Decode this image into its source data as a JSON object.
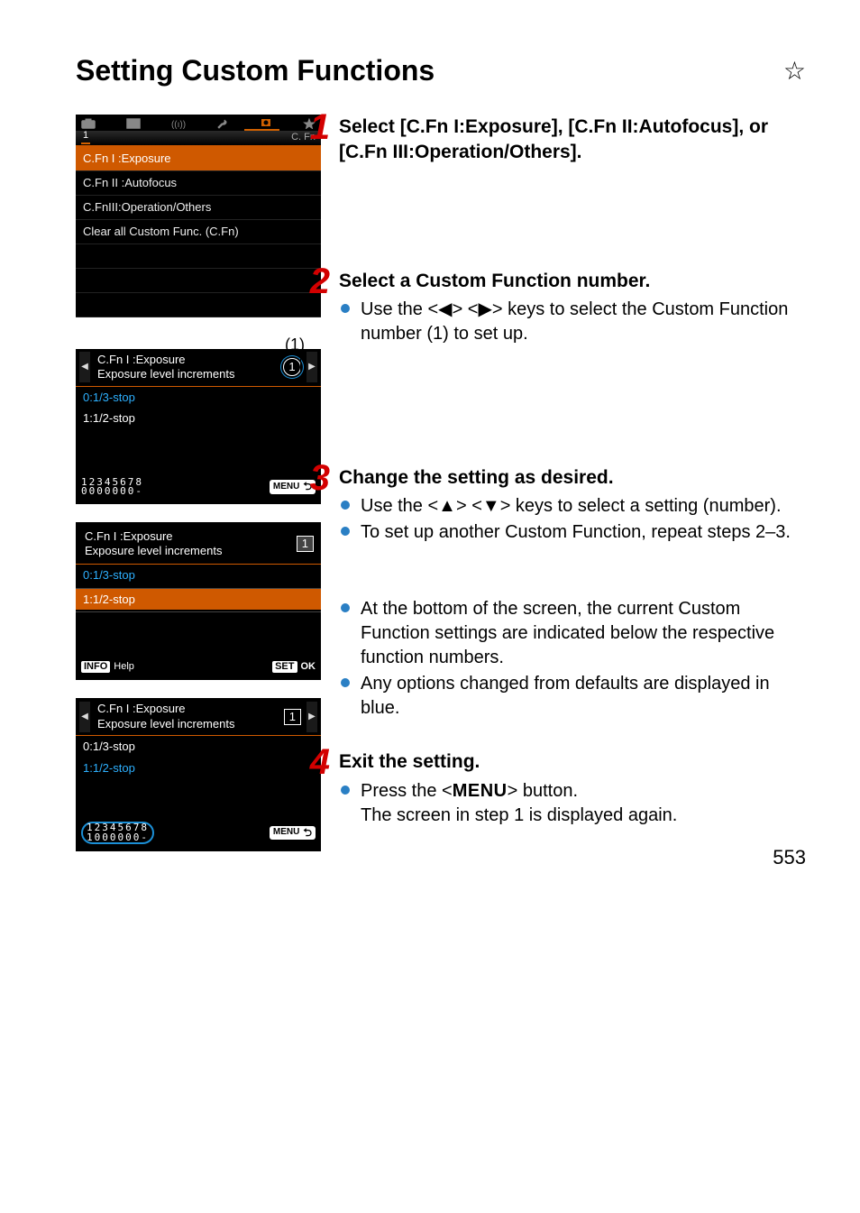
{
  "title": "Setting Custom Functions",
  "star": "☆",
  "page_number": "553",
  "screens": {
    "menu": {
      "tab_cfn_label": "C. Fn",
      "tab_num": "1",
      "items": [
        "C.Fn I :Exposure",
        "C.Fn II :Autofocus",
        "C.FnIII:Operation/Others",
        "Clear all Custom Func. (C.Fn)"
      ]
    },
    "s2": {
      "callout": "(1)",
      "title": "C.Fn I :Exposure",
      "subtitle": "Exposure level increments",
      "badge": "1",
      "opts": [
        "0:1/3-stop",
        "1:1/2-stop"
      ],
      "funcnums_top": "12345678",
      "funcnums_bot": "0000000-",
      "menu_btn": "MENU"
    },
    "s3": {
      "title": "C.Fn I :Exposure",
      "subtitle": "Exposure level increments",
      "badge": "1",
      "opts": [
        "0:1/3-stop",
        "1:1/2-stop"
      ],
      "info": "INFO",
      "help": "Help",
      "set": "SET",
      "ok": "OK"
    },
    "s4": {
      "title": "C.Fn I :Exposure",
      "subtitle": "Exposure level increments",
      "badge": "1",
      "opts": [
        "0:1/3-stop",
        "1:1/2-stop"
      ],
      "funcnums_top": "12345678",
      "funcnums_bot": "1000000-",
      "menu_btn": "MENU"
    }
  },
  "steps": {
    "s1": {
      "num": "1",
      "heading": "Select [C.Fn I:Exposure], [C.Fn II:Autofocus], or [C.Fn III:Operation/Others]."
    },
    "s2": {
      "num": "2",
      "heading": "Select a Custom Function number.",
      "bullet1_a": "Use the <",
      "bullet1_left": "◀",
      "bullet1_b": "> <",
      "bullet1_right": "▶",
      "bullet1_c": "> keys to select the Custom Function number (1) to set up."
    },
    "s3": {
      "num": "3",
      "heading": "Change the setting as desired.",
      "bullet1_a": "Use the <",
      "bullet1_up": "▲",
      "bullet1_b": "> <",
      "bullet1_down": "▼",
      "bullet1_c": "> keys to select a setting (number).",
      "bullet2": "To set up another Custom Function, repeat steps 2–3.",
      "bullet3": "At the bottom of the screen, the current Custom Function settings are indicated below the respective function numbers.",
      "bullet4": "Any options changed from defaults are displayed in blue."
    },
    "s4": {
      "num": "4",
      "heading": "Exit the setting.",
      "bullet1_a": "Press the <",
      "bullet1_menu": "MENU",
      "bullet1_b": "> button.",
      "bullet1_cont": "The screen in step 1 is displayed again."
    }
  }
}
